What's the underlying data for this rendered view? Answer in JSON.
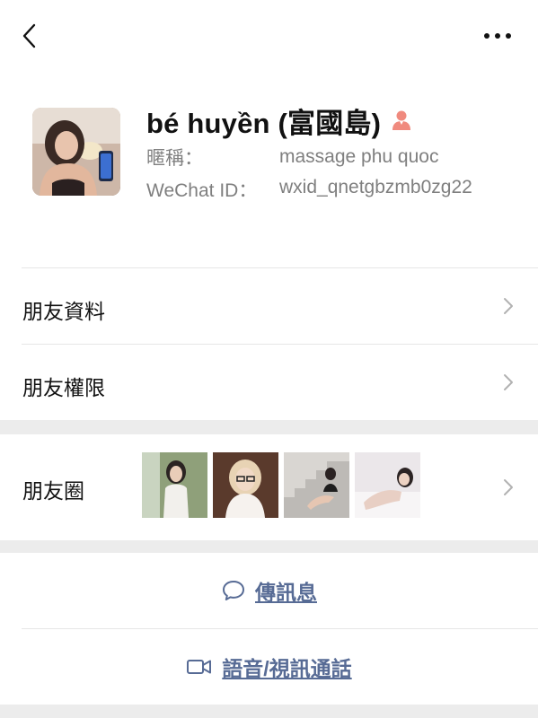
{
  "profile": {
    "display_name": "bé huyền (富國島)",
    "nickname_label": "暱稱：",
    "nickname_value": "massage phu quoc",
    "wechat_id_label": "WeChat ID：",
    "wechat_id_value": "wxid_qnetgbzmb0zg22",
    "gender_icon": "female-user-icon",
    "gender_color": "#fa5151"
  },
  "menu": {
    "friend_info": "朋友資料",
    "friend_permissions": "朋友權限",
    "moments": "朋友圈"
  },
  "actions": {
    "send_message": "傳訊息",
    "voice_video_call": "語音/視訊通話"
  },
  "colors": {
    "link": "#576b95",
    "separator": "#ececec",
    "muted_text": "#7f7f7f"
  },
  "icons": {
    "back": "chevron-left-icon",
    "more": "more-dots-icon",
    "message": "chat-bubble-icon",
    "video": "video-camera-icon",
    "row_arrow": "chevron-right-icon"
  }
}
